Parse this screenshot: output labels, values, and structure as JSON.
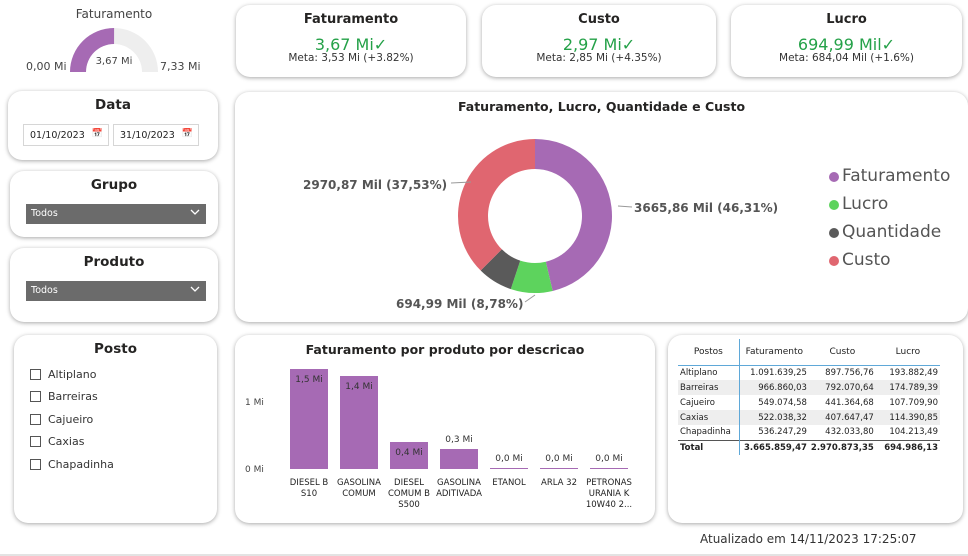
{
  "gauge": {
    "title": "Faturamento",
    "min_label": "0,00 Mi",
    "max_label": "7,33 Mi",
    "value_label": "3,67 Mi",
    "min": 0,
    "max": 7.33,
    "value": 3.67,
    "fill_color": "#a66ab4",
    "track_color": "#eeeeee"
  },
  "kpis": [
    {
      "title": "Faturamento",
      "value": "3,67 Mi✓",
      "meta": "Meta: 3,53 Mi (+3.82%)"
    },
    {
      "title": "Custo",
      "value": "2,97 Mi✓",
      "meta": "Meta: 2,85 Mi (+4.35%)"
    },
    {
      "title": "Lucro",
      "value": "694,99 Mil✓",
      "meta": "Meta: 684,04 Mil (+1.6%)"
    }
  ],
  "data_slicer": {
    "title": "Data",
    "start": "01/10/2023",
    "end": "31/10/2023",
    "calendar_icon": "calendar-icon"
  },
  "grupo_slicer": {
    "title": "Grupo",
    "selected": "Todos"
  },
  "produto_slicer": {
    "title": "Produto",
    "selected": "Todos"
  },
  "posto_slicer": {
    "title": "Posto",
    "items": [
      "Altiplano",
      "Barreiras",
      "Cajueiro",
      "Caxias",
      "Chapadinha"
    ]
  },
  "donut": {
    "title": "Faturamento, Lucro, Quantidade e Custo",
    "labels": {
      "faturamento": "3665,86 Mil (46,31%)",
      "custo": "2970,87 Mil (37,53%)",
      "lucro": "694,99 Mil (8,78%)"
    },
    "legend": [
      "Faturamento",
      "Lucro",
      "Quantidade",
      "Custo"
    ]
  },
  "bar_chart": {
    "title": "Faturamento por produto por descricao",
    "y_ticks": [
      "1 Mi",
      "0 Mi"
    ],
    "labels": [
      {
        "value": "1,5 Mi",
        "cat": [
          "DIESEL B",
          "S10"
        ]
      },
      {
        "value": "1,4 Mi",
        "cat": [
          "GASOLINA",
          "COMUM"
        ]
      },
      {
        "value": "0,4 Mi",
        "cat": [
          "DIESEL",
          "COMUM B",
          "S500"
        ]
      },
      {
        "value": "0,3 Mi",
        "cat": [
          "GASOLINA",
          "ADITIVADA"
        ]
      },
      {
        "value": "0,0 Mi",
        "cat": [
          "ETANOL"
        ]
      },
      {
        "value": "0,0 Mi",
        "cat": [
          "ARLA 32"
        ]
      },
      {
        "value": "0,0 Mi",
        "cat": [
          "PETRONAS",
          "URANIA K",
          "10W40 2..."
        ]
      }
    ]
  },
  "table": {
    "headers": [
      "Postos",
      "Faturamento",
      "Custo",
      "Lucro"
    ],
    "rows": [
      [
        "Altiplano",
        "1.091.639,25",
        "897.756,76",
        "193.882,49"
      ],
      [
        "Barreiras",
        "966.860,03",
        "792.070,64",
        "174.789,39"
      ],
      [
        "Cajueiro",
        "549.074,58",
        "441.364,68",
        "107.709,90"
      ],
      [
        "Caxias",
        "522.038,32",
        "407.647,47",
        "114.390,85"
      ],
      [
        "Chapadinha",
        "536.247,29",
        "432.033,80",
        "104.213,49"
      ]
    ],
    "total": [
      "Total",
      "3.665.859,47",
      "2.970.873,35",
      "694.986,13"
    ]
  },
  "updated": "Atualizado em 14/11/2023 17:25:07",
  "chart_data": [
    {
      "type": "pie",
      "title": "Faturamento, Lucro, Quantidade e Custo",
      "categories": [
        "Faturamento",
        "Lucro",
        "Quantidade",
        "Custo"
      ],
      "values": [
        3665.86,
        694.99,
        584.0,
        2970.87
      ],
      "percent": [
        46.31,
        8.78,
        7.38,
        37.53
      ],
      "colors": [
        "#a66ab4",
        "#5dd35d",
        "#5a5a5a",
        "#e06670"
      ],
      "legend": "right"
    },
    {
      "type": "bar",
      "title": "Faturamento por produto por descricao",
      "categories": [
        "DIESEL B S10",
        "GASOLINA COMUM",
        "DIESEL COMUM B S500",
        "GASOLINA ADITIVADA",
        "ETANOL",
        "ARLA 32",
        "PETRONAS URANIA K 10W40 2..."
      ],
      "values": [
        1.5,
        1.4,
        0.4,
        0.3,
        0.02,
        0.01,
        0.005
      ],
      "ylim": [
        0,
        1.5
      ],
      "ylabel": "",
      "xlabel": "",
      "color": "#a66ab4"
    }
  ]
}
